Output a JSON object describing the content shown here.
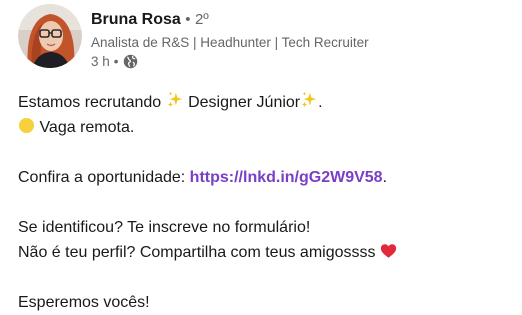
{
  "author": {
    "name": "Bruna Rosa",
    "separator": "•",
    "degree": "2º",
    "headline": "Analista de R&S | Headhunter | Tech Recruiter",
    "timestamp": "3 h",
    "visibility_icon": "globe-icon"
  },
  "post": {
    "line1_text": "Estamos recrutando ",
    "line1_role": " Designer Júnior",
    "line1_end": ".",
    "line2_text": " Vaga remota.",
    "line3_text": "Confira a oportunidade: ",
    "link_text": "https://lnkd.in/gG2W9V58",
    "line3_end": ".",
    "line4_text": "Se identificou? Te inscreve no formulário!",
    "line5_text": "Não é teu perfil? Compartilha com teus amigossss ",
    "line6_text": "Esperemos vocês!"
  },
  "colors": {
    "link": "#7a3fc6",
    "secondary_text": "#666666",
    "primary_text": "#191919",
    "sparkle": "#f5c518",
    "yellow_circle": "#f7d13b",
    "heart": "#e2283b"
  }
}
